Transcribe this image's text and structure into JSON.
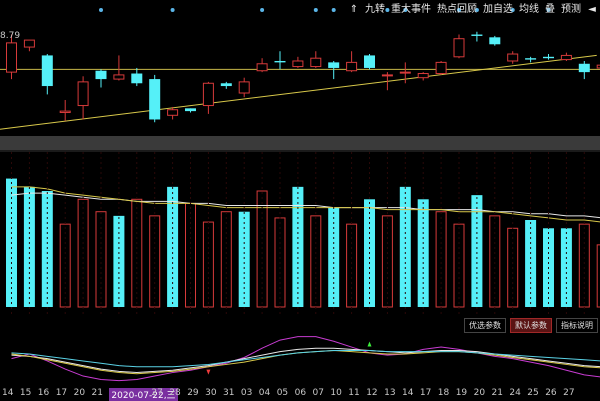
{
  "toolbar": {
    "up_arrow": "⇑",
    "buttons": [
      "九转",
      "重大事件",
      "热点回顾",
      "加自选",
      "均线",
      "叠",
      "预测"
    ],
    "more": "◄"
  },
  "main": {
    "price_label": "8.79",
    "dot_color": "#5ab4e6"
  },
  "indicator": {
    "buttons": [
      {
        "label": "优选参数",
        "active": false
      },
      {
        "label": "默认参数",
        "active": true
      },
      {
        "label": "指标说明",
        "active": false
      }
    ]
  },
  "xaxis": {
    "ticks": [
      "14",
      "15",
      "16",
      "17",
      "20",
      "21",
      "2020-07-22,三",
      "27",
      "28",
      "29",
      "30",
      "31",
      "03",
      "04",
      "05",
      "06",
      "07",
      "10",
      "11",
      "12",
      "13",
      "14",
      "17",
      "18",
      "19",
      "20",
      "21",
      "24",
      "25",
      "26",
      "27"
    ]
  },
  "chart_data": [
    {
      "type": "candlestick",
      "title": "",
      "up_color": "#d63a3a",
      "down_color": "#55f0f8",
      "candles": [
        {
          "o": 6.6,
          "c": 8.7,
          "h": 9.3,
          "l": 6.1
        },
        {
          "o": 8.4,
          "c": 8.9,
          "h": 8.8,
          "l": 8.1
        },
        {
          "o": 7.8,
          "c": 5.6,
          "h": 7.9,
          "l": 5.0
        },
        {
          "o": 3.7,
          "c": 3.8,
          "h": 4.6,
          "l": 3.1
        },
        {
          "o": 4.2,
          "c": 5.9,
          "h": 6.3,
          "l": 3.2
        },
        {
          "o": 6.7,
          "c": 6.1,
          "h": 6.8,
          "l": 5.5
        },
        {
          "o": 6.1,
          "c": 6.4,
          "h": 7.8,
          "l": 6.0
        },
        {
          "o": 6.5,
          "c": 5.8,
          "h": 6.9,
          "l": 5.6
        },
        {
          "o": 6.1,
          "c": 3.2,
          "h": 6.4,
          "l": 3.0
        },
        {
          "o": 3.5,
          "c": 3.9,
          "h": 4.1,
          "l": 3.2
        },
        {
          "o": 4.0,
          "c": 3.8,
          "h": 4.0,
          "l": 3.7
        },
        {
          "o": 4.2,
          "c": 5.8,
          "h": 5.9,
          "l": 3.6
        },
        {
          "o": 5.8,
          "c": 5.6,
          "h": 5.9,
          "l": 5.4
        },
        {
          "o": 5.1,
          "c": 5.9,
          "h": 6.2,
          "l": 4.8
        },
        {
          "o": 6.7,
          "c": 7.2,
          "h": 7.6,
          "l": 6.6
        },
        {
          "o": 7.4,
          "c": 7.3,
          "h": 8.1,
          "l": 6.8
        },
        {
          "o": 7.0,
          "c": 7.4,
          "h": 7.7,
          "l": 6.9
        },
        {
          "o": 7.0,
          "c": 7.6,
          "h": 8.1,
          "l": 6.9
        },
        {
          "o": 7.3,
          "c": 6.9,
          "h": 7.4,
          "l": 6.1
        },
        {
          "o": 6.7,
          "c": 7.3,
          "h": 8.1,
          "l": 6.6
        },
        {
          "o": 7.8,
          "c": 6.9,
          "h": 7.9,
          "l": 6.8
        },
        {
          "o": 6.4,
          "c": 6.4,
          "h": 6.6,
          "l": 5.3
        },
        {
          "o": 6.6,
          "c": 6.6,
          "h": 7.3,
          "l": 5.8
        },
        {
          "o": 6.2,
          "c": 6.5,
          "h": 6.6,
          "l": 6.0
        },
        {
          "o": 6.5,
          "c": 7.3,
          "h": 7.4,
          "l": 6.4
        },
        {
          "o": 7.7,
          "c": 9.0,
          "h": 9.3,
          "l": 7.6
        },
        {
          "o": 9.3,
          "c": 9.2,
          "h": 9.5,
          "l": 8.8
        },
        {
          "o": 9.1,
          "c": 8.6,
          "h": 9.2,
          "l": 8.5
        },
        {
          "o": 7.4,
          "c": 7.9,
          "h": 8.1,
          "l": 7.2
        },
        {
          "o": 7.6,
          "c": 7.5,
          "h": 7.7,
          "l": 7.3
        },
        {
          "o": 7.7,
          "c": 7.6,
          "h": 7.9,
          "l": 7.5
        },
        {
          "o": 7.5,
          "c": 7.8,
          "h": 8.0,
          "l": 7.4
        },
        {
          "o": 7.2,
          "c": 6.6,
          "h": 7.4,
          "l": 6.1
        },
        {
          "o": 6.9,
          "c": 7.1,
          "h": 7.2,
          "l": 6.5
        }
      ],
      "dot_indices": [
        5,
        9,
        14,
        17,
        18,
        21,
        22,
        25,
        26,
        28,
        30
      ],
      "hline": 6.8,
      "trendline": [
        [
          0,
          2.5
        ],
        [
          33,
          7.8
        ]
      ],
      "ylim": [
        2.3,
        10.2
      ]
    },
    {
      "type": "bar",
      "title": "",
      "values": [
        62,
        58,
        56,
        40,
        52,
        46,
        44,
        52,
        44,
        58,
        50,
        41,
        46,
        46,
        56,
        43,
        58,
        44,
        48,
        40,
        52,
        44,
        58,
        52,
        46,
        40,
        54,
        44,
        38,
        42,
        38,
        38,
        40,
        30
      ],
      "up_down": [
        "d",
        "d",
        "d",
        "u",
        "u",
        "u",
        "d",
        "u",
        "u",
        "d",
        "u",
        "u",
        "u",
        "d",
        "u",
        "u",
        "d",
        "u",
        "d",
        "u",
        "d",
        "u",
        "d",
        "d",
        "u",
        "u",
        "d",
        "u",
        "u",
        "d",
        "d",
        "d",
        "u",
        "u"
      ],
      "ma": [
        58,
        58,
        57,
        55,
        54,
        53,
        52,
        51,
        50,
        50,
        50,
        49,
        48,
        48,
        48,
        48,
        48,
        48,
        48,
        48,
        48,
        47,
        47,
        47,
        47,
        46,
        46,
        46,
        45,
        44,
        43,
        42,
        42,
        41
      ],
      "ma2": [
        54,
        55,
        55,
        54,
        53,
        52,
        52,
        51,
        51,
        51,
        50,
        50,
        49,
        49,
        49,
        49,
        49,
        49,
        48,
        48,
        48,
        48,
        48,
        47,
        47,
        47,
        47,
        46,
        46,
        45,
        45,
        44,
        44,
        43
      ],
      "ylim": [
        0,
        70
      ]
    },
    {
      "type": "line",
      "title": "",
      "series": [
        {
          "color": "#c83cd2",
          "values": [
            42,
            50,
            38,
            24,
            12,
            6,
            4,
            6,
            12,
            18,
            22,
            28,
            34,
            44,
            60,
            74,
            80,
            80,
            72,
            62,
            52,
            48,
            50,
            58,
            62,
            58,
            52,
            46,
            42,
            36,
            30,
            22,
            14,
            10
          ]
        },
        {
          "color": "#e8e8e8",
          "values": [
            48,
            46,
            42,
            36,
            30,
            24,
            20,
            18,
            20,
            22,
            26,
            30,
            36,
            42,
            48,
            54,
            58,
            60,
            60,
            58,
            56,
            54,
            52,
            54,
            56,
            56,
            54,
            50,
            46,
            42,
            38,
            34,
            30,
            28
          ]
        },
        {
          "color": "#d8c84a",
          "values": [
            50,
            46,
            40,
            34,
            28,
            22,
            18,
            16,
            18,
            20,
            24,
            28,
            32,
            36,
            42,
            48,
            52,
            54,
            56,
            54,
            52,
            50,
            50,
            52,
            54,
            54,
            52,
            48,
            44,
            40,
            36,
            32,
            28,
            26
          ]
        },
        {
          "color": "#5ad2e6",
          "values": [
            52,
            50,
            46,
            42,
            38,
            34,
            30,
            28,
            28,
            28,
            30,
            32,
            36,
            40,
            44,
            48,
            52,
            54,
            56,
            56,
            56,
            54,
            54,
            54,
            54,
            54,
            52,
            50,
            48,
            46,
            44,
            42,
            40,
            38
          ]
        }
      ],
      "markers": [
        {
          "index": 11,
          "type": "up",
          "color": "#f03c3c"
        },
        {
          "index": 20,
          "type": "down",
          "color": "#3cf03c"
        }
      ],
      "ylim": [
        0,
        100
      ]
    }
  ]
}
